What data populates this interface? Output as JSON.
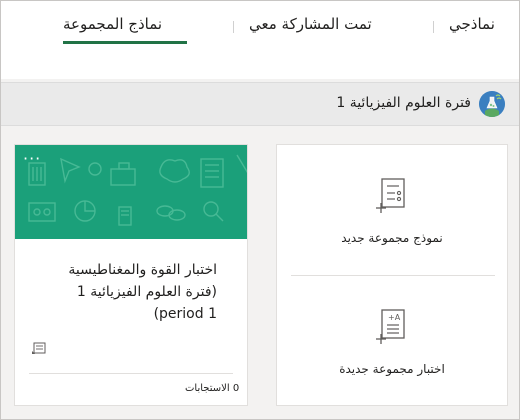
{
  "tabs": [
    {
      "label": "نماذجي"
    },
    {
      "label": "تمت المشاركة معي"
    },
    {
      "label": "نماذج المجموعة"
    }
  ],
  "group": {
    "title": "فترة العلوم الفيزيائية 1",
    "avatar_icon": "science-flask-icon"
  },
  "create": {
    "new_form_label": "نموذج مجموعة جديد",
    "new_quiz_label": "اختبار مجموعة جديدة"
  },
  "form_card": {
    "title_line1": "اختبار القوة والمغناطيسية",
    "title_line2": "(فترة العلوم الفيزيائية 1",
    "title_line3": "period 1)",
    "responses": "0 الاستجابات",
    "more_label": "···",
    "banner_color": "#1ba07a"
  },
  "colors": {
    "accent": "#217346",
    "banner": "#1ba07a"
  }
}
